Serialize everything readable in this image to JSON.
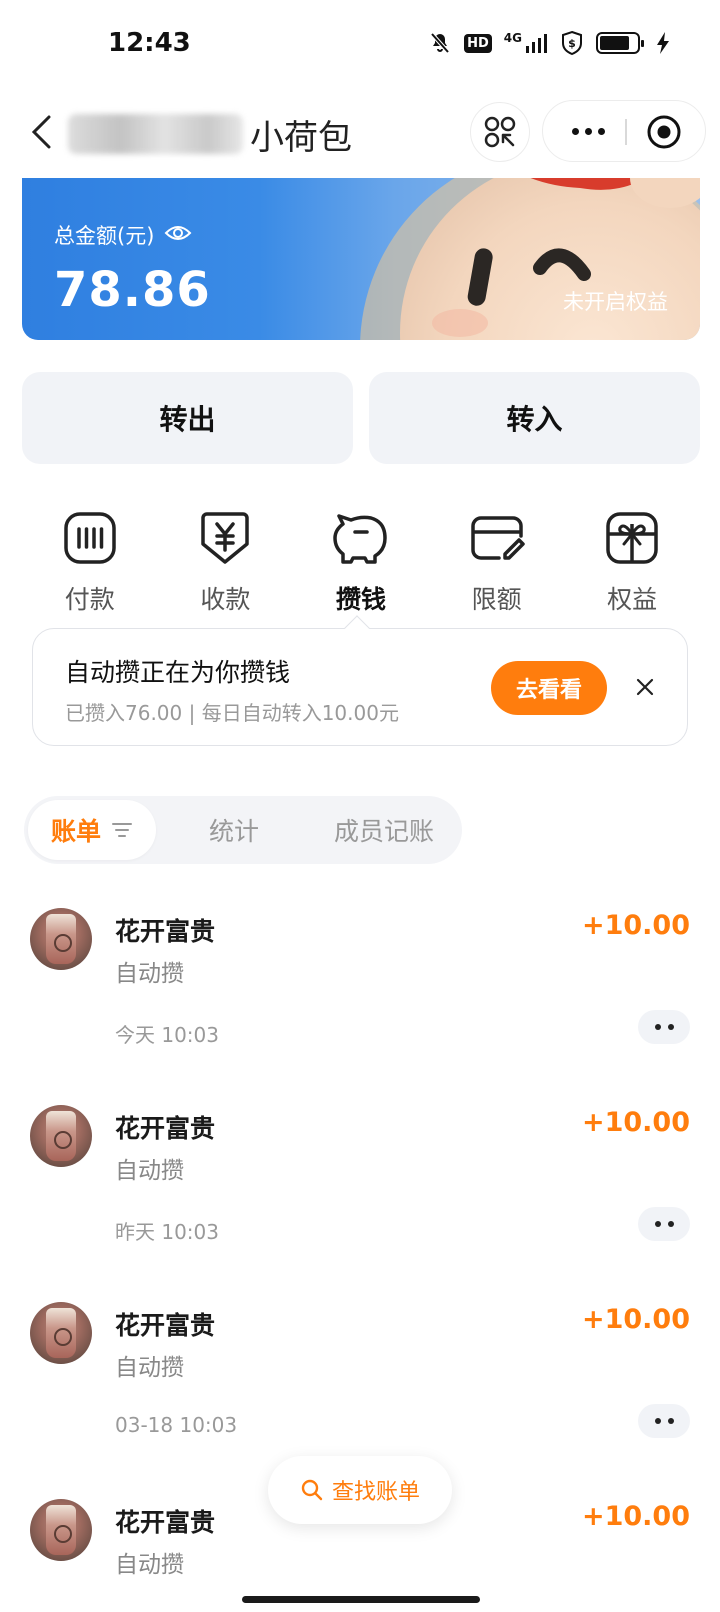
{
  "status_bar": {
    "time": "12:43",
    "hd_badge": "HD",
    "network": "4G",
    "icons": [
      "mute-icon",
      "hd-icon",
      "signal-icon",
      "vpn-shield-icon",
      "battery-icon",
      "charging-icon"
    ],
    "battery_level": 0.8
  },
  "nav": {
    "title": "小荷包",
    "blurred_owner_name": "",
    "icons": [
      "back-icon",
      "scan-icon",
      "more-icon",
      "close-target-icon"
    ]
  },
  "balance_card": {
    "label": "总金额(元)",
    "amount": "78.86",
    "benefit_text": "未开启权益",
    "eye_icon": "eye-icon"
  },
  "actions": {
    "transfer_out": "转出",
    "transfer_in": "转入"
  },
  "features": [
    {
      "label": "付款",
      "icon": "pay-card-icon"
    },
    {
      "label": "收款",
      "icon": "yuan-receive-icon"
    },
    {
      "label": "攒钱",
      "icon": "piggy-bank-icon"
    },
    {
      "label": "限额",
      "icon": "limit-card-icon"
    },
    {
      "label": "权益",
      "icon": "gift-icon"
    }
  ],
  "tip": {
    "title": "自动攒正在为你攒钱",
    "subtitle": "已攒入76.00 | 每日自动转入10.00元",
    "button": "去看看"
  },
  "tabs": {
    "bill": "账单",
    "stats": "统计",
    "members": "成员记账"
  },
  "transactions": [
    {
      "name": "花开富贵",
      "type": "自动攒",
      "time": "今天 10:03",
      "amount": "+10.00"
    },
    {
      "name": "花开富贵",
      "type": "自动攒",
      "time": "昨天 10:03",
      "amount": "+10.00"
    },
    {
      "name": "花开富贵",
      "type": "自动攒",
      "time": "03-18 10:03",
      "amount": "+10.00"
    },
    {
      "name": "花开富贵",
      "type": "自动攒",
      "time": "",
      "amount": "+10.00"
    }
  ],
  "float_search": {
    "label": "查找账单"
  },
  "colors": {
    "accent": "#ff7d0d",
    "card_blue": "#2f7fe0",
    "button_bg": "#f1f3f7"
  }
}
